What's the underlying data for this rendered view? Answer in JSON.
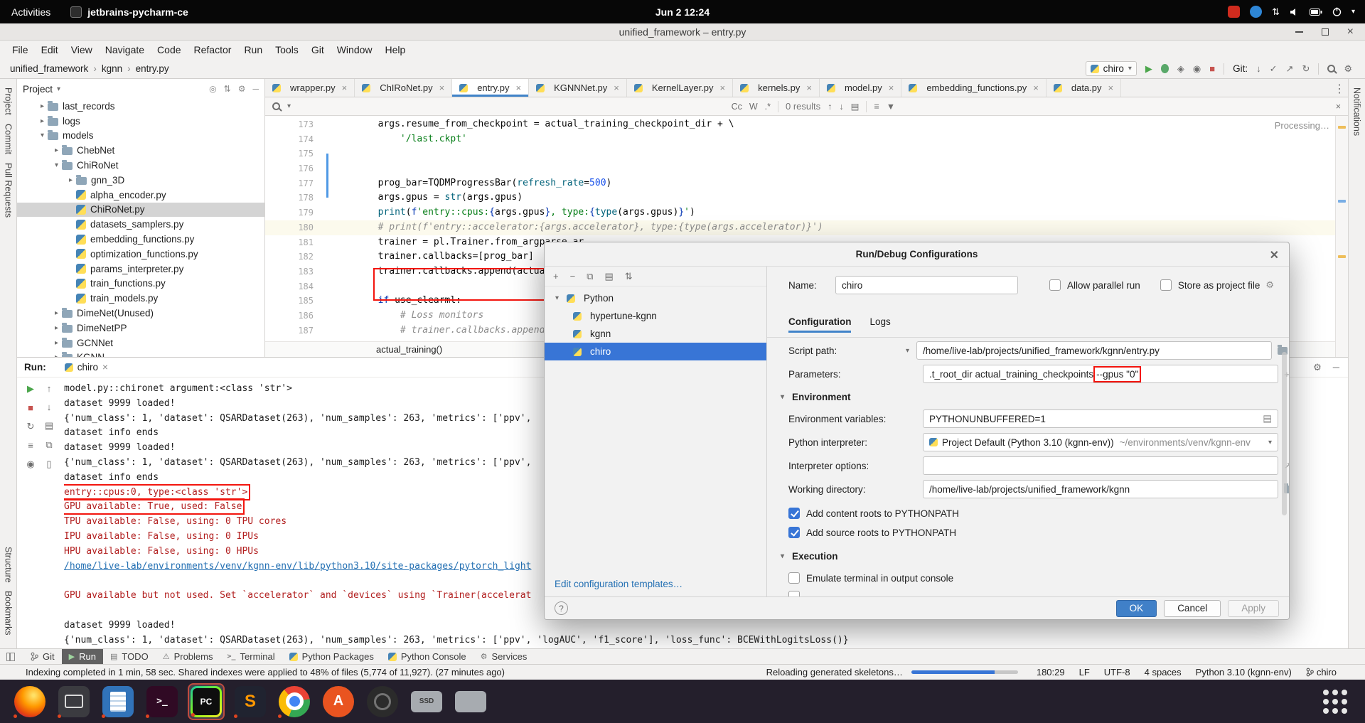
{
  "system_bar": {
    "activities": "Activities",
    "app": "jetbrains-pycharm-ce",
    "clock": "Jun 2  12:24"
  },
  "window": {
    "title": "unified_framework – entry.py"
  },
  "menu": [
    "File",
    "Edit",
    "View",
    "Navigate",
    "Code",
    "Refactor",
    "Run",
    "Tools",
    "Git",
    "Window",
    "Help"
  ],
  "navbar": {
    "breadcrumbs": [
      "unified_framework",
      "kgnn",
      "entry.py"
    ],
    "run_config": "chiro",
    "git_label": "Git:"
  },
  "tool_stripes": {
    "left_top": [
      "Project",
      "Commit",
      "Pull Requests"
    ],
    "left_bottom": [
      "Structure",
      "Bookmarks"
    ],
    "right_top": [
      "Notifications"
    ]
  },
  "project": {
    "header": "Project",
    "tree": [
      {
        "label": "last_records",
        "depth": 1,
        "kind": "folder",
        "chev": "collapsed"
      },
      {
        "label": "logs",
        "depth": 1,
        "kind": "folder",
        "chev": "collapsed"
      },
      {
        "label": "models",
        "depth": 1,
        "kind": "folder",
        "chev": "expanded"
      },
      {
        "label": "ChebNet",
        "depth": 2,
        "kind": "folder",
        "chev": "collapsed"
      },
      {
        "label": "ChiRoNet",
        "depth": 2,
        "kind": "folder",
        "chev": "expanded"
      },
      {
        "label": "gnn_3D",
        "depth": 3,
        "kind": "folder",
        "chev": "collapsed"
      },
      {
        "label": "alpha_encoder.py",
        "depth": 3,
        "kind": "py"
      },
      {
        "label": "ChiRoNet.py",
        "depth": 3,
        "kind": "py",
        "selected": true
      },
      {
        "label": "datasets_samplers.py",
        "depth": 3,
        "kind": "py"
      },
      {
        "label": "embedding_functions.py",
        "depth": 3,
        "kind": "py"
      },
      {
        "label": "optimization_functions.py",
        "depth": 3,
        "kind": "py"
      },
      {
        "label": "params_interpreter.py",
        "depth": 3,
        "kind": "py"
      },
      {
        "label": "train_functions.py",
        "depth": 3,
        "kind": "py"
      },
      {
        "label": "train_models.py",
        "depth": 3,
        "kind": "py"
      },
      {
        "label": "DimeNet(Unused)",
        "depth": 2,
        "kind": "folder",
        "chev": "collapsed"
      },
      {
        "label": "DimeNetPP",
        "depth": 2,
        "kind": "folder",
        "chev": "collapsed"
      },
      {
        "label": "GCNNet",
        "depth": 2,
        "kind": "folder",
        "chev": "collapsed"
      },
      {
        "label": "KGNN",
        "depth": 2,
        "kind": "folder",
        "chev": "collapsed"
      }
    ]
  },
  "editor": {
    "tabs": [
      {
        "label": "wrapper.py"
      },
      {
        "label": "ChIRoNet.py"
      },
      {
        "label": "entry.py",
        "active": true
      },
      {
        "label": "KGNNNet.py"
      },
      {
        "label": "KernelLayer.py"
      },
      {
        "label": "kernels.py"
      },
      {
        "label": "model.py"
      },
      {
        "label": "embedding_functions.py"
      },
      {
        "label": "data.py"
      }
    ],
    "search": {
      "match_case": "Cc",
      "words": "W",
      "regex": ".*",
      "results": "0 results"
    },
    "processing": "Processing…",
    "breadcrumb": "actual_training()",
    "code": [
      {
        "n": 173,
        "ind": 8,
        "seg": [
          [
            "p",
            "args.resume_from_checkpoint = actual_training_checkpoint_dir + \\"
          ]
        ]
      },
      {
        "n": 174,
        "ind": 12,
        "seg": [
          [
            "s",
            "'/last.ckpt'"
          ]
        ]
      },
      {
        "n": 175,
        "ind": 0,
        "seg": []
      },
      {
        "n": 176,
        "ind": 0,
        "seg": []
      },
      {
        "n": 177,
        "ind": 8,
        "seg": [
          [
            "p",
            "prog_bar=TQDMProgressBar("
          ],
          [
            "d",
            "refresh_rate"
          ],
          [
            "p",
            "="
          ],
          [
            "n",
            "500"
          ],
          [
            "p",
            ")"
          ]
        ]
      },
      {
        "n": 178,
        "ind": 8,
        "seg": [
          [
            "p",
            "args.gpus = "
          ],
          [
            "b",
            "str"
          ],
          [
            "p",
            "(args.gpus)"
          ]
        ]
      },
      {
        "n": 179,
        "ind": 8,
        "seg": [
          [
            "b",
            "print"
          ],
          [
            "p",
            "("
          ],
          [
            "k",
            "f"
          ],
          [
            "s",
            "'entry::cpus:"
          ],
          [
            "k",
            "{"
          ],
          [
            "p",
            "args.gpus"
          ],
          [
            "k",
            "}"
          ],
          [
            "s",
            ", type:"
          ],
          [
            "k",
            "{"
          ],
          [
            "b",
            "type"
          ],
          [
            "p",
            "(args.gpus)"
          ],
          [
            "k",
            "}"
          ],
          [
            "s",
            "'"
          ],
          [
            "p",
            ")"
          ]
        ]
      },
      {
        "n": 180,
        "ind": 8,
        "current": true,
        "seg": [
          [
            "c",
            "# print(f'entry::accelerator:{args.accelerator}, type:{type(args.accelerator)}')"
          ]
        ]
      },
      {
        "n": 181,
        "ind": 8,
        "seg": [
          [
            "p",
            "trainer = pl.Trainer.from_argparse_ar"
          ]
        ]
      },
      {
        "n": 182,
        "ind": 8,
        "seg": [
          [
            "p",
            "trainer.callbacks=[prog_bar]"
          ]
        ]
      },
      {
        "n": 183,
        "ind": 8,
        "seg": [
          [
            "p",
            "trainer.callbacks.append(actual_trai"
          ]
        ]
      },
      {
        "n": 184,
        "ind": 0,
        "seg": []
      },
      {
        "n": 185,
        "ind": 8,
        "seg": [
          [
            "k",
            "if"
          ],
          [
            "p",
            " use_clearml:"
          ]
        ]
      },
      {
        "n": 186,
        "ind": 12,
        "seg": [
          [
            "c",
            "# Loss monitors"
          ]
        ]
      },
      {
        "n": 187,
        "ind": 12,
        "seg": [
          [
            "c",
            "# trainer.callbacks.append("
          ]
        ]
      }
    ]
  },
  "run": {
    "label": "Run:",
    "tab": "chiro",
    "console": [
      {
        "t": "model.py::chironet argument:<class 'str'>",
        "c": "out"
      },
      {
        "t": "dataset 9999 loaded!",
        "c": "out"
      },
      {
        "t": "{'num_class': 1, 'dataset': QSARDataset(263), 'num_samples': 263, 'metrics': ['ppv',",
        "c": "out"
      },
      {
        "t": "dataset info ends",
        "c": "out"
      },
      {
        "t": "dataset 9999 loaded!",
        "c": "out"
      },
      {
        "t": "{'num_class': 1, 'dataset': QSARDataset(263), 'num_samples': 263, 'metrics': ['ppv',",
        "c": "out"
      },
      {
        "t": "dataset info ends",
        "c": "out"
      },
      {
        "t": "entry::cpus:0, type:<class 'str'>",
        "c": "err",
        "boxed": true
      },
      {
        "t": "GPU available: True, used: False",
        "c": "err",
        "boxed": true
      },
      {
        "t": "TPU available: False, using: 0 TPU cores",
        "c": "err"
      },
      {
        "t": "IPU available: False, using: 0 IPUs",
        "c": "err"
      },
      {
        "t": "HPU available: False, using: 0 HPUs",
        "c": "err"
      },
      {
        "t": "/home/live-lab/environments/venv/kgnn-env/lib/python3.10/site-packages/pytorch_light",
        "c": "link"
      },
      {
        "t": "",
        "c": "out"
      },
      {
        "t": "GPU available but not used. Set `accelerator` and `devices` using `Trainer(accelerat",
        "c": "err"
      },
      {
        "t": "",
        "c": "out"
      },
      {
        "t": "dataset 9999 loaded!",
        "c": "out"
      },
      {
        "t": "{'num_class': 1, 'dataset': QSARDataset(263), 'num_samples': 263, 'metrics': ['ppv', 'logAUC', 'f1_score'], 'loss_func': BCEWithLogitsLoss()}",
        "c": "out"
      },
      {
        "t": "dataset info ends",
        "c": "out"
      }
    ]
  },
  "dialog": {
    "title": "Run/Debug Configurations",
    "tree_root": "Python",
    "tree_items": [
      "hypertune-kgnn",
      "kgnn",
      "chiro"
    ],
    "selected_item": "chiro",
    "name_label": "Name:",
    "name_value": "chiro",
    "allow_parallel": "Allow parallel run",
    "store_as_file": "Store as project file",
    "tabs": [
      "Configuration",
      "Logs"
    ],
    "script_path_label": "Script path:",
    "script_path": "/home/live-lab/projects/unified_framework/kgnn/entry.py",
    "parameters_label": "Parameters:",
    "parameters_pre": ".t_root_dir actual_training_checkpoints",
    "parameters_boxed": "--gpus \"0\"",
    "env_section": "Environment",
    "env_vars_label": "Environment variables:",
    "env_vars": "PYTHONUNBUFFERED=1",
    "interpreter_label": "Python interpreter:",
    "interpreter": "Project Default (Python 3.10 (kgnn-env))",
    "interpreter_path": "~/environments/venv/kgnn-env",
    "interp_options_label": "Interpreter options:",
    "workdir_label": "Working directory:",
    "workdir": "/home/live-lab/projects/unified_framework/kgnn",
    "cb_content_roots": "Add content roots to PYTHONPATH",
    "cb_source_roots": "Add source roots to PYTHONPATH",
    "exec_section": "Execution",
    "cb_emulate": "Emulate terminal in output console",
    "edit_templates": "Edit configuration templates…",
    "ok": "OK",
    "cancel": "Cancel",
    "apply": "Apply"
  },
  "bottom_tabs": [
    {
      "label": "Git"
    },
    {
      "label": "Run",
      "active": true
    },
    {
      "label": "TODO"
    },
    {
      "label": "Problems"
    },
    {
      "label": "Terminal"
    },
    {
      "label": "Python Packages"
    },
    {
      "label": "Python Console"
    },
    {
      "label": "Services"
    }
  ],
  "status_bar": {
    "message": "Indexing completed in 1 min, 58 sec. Shared indexes were applied to 48% of files (5,774 of 11,927). (27 minutes ago)",
    "progress_label": "Reloading generated skeletons…",
    "caret": "180:29",
    "line_sep": "LF",
    "encoding": "UTF-8",
    "indent": "4 spaces",
    "interpreter": "Python 3.10 (kgnn-env)",
    "branch": "chiro"
  },
  "dock": [
    "firefox",
    "screenshot-tool",
    "text-editor",
    "terminal",
    "pycharm",
    "sublime-text",
    "chrome",
    "ubuntu-software",
    "camera",
    "ssd-drive",
    "drive",
    "app-grid"
  ]
}
